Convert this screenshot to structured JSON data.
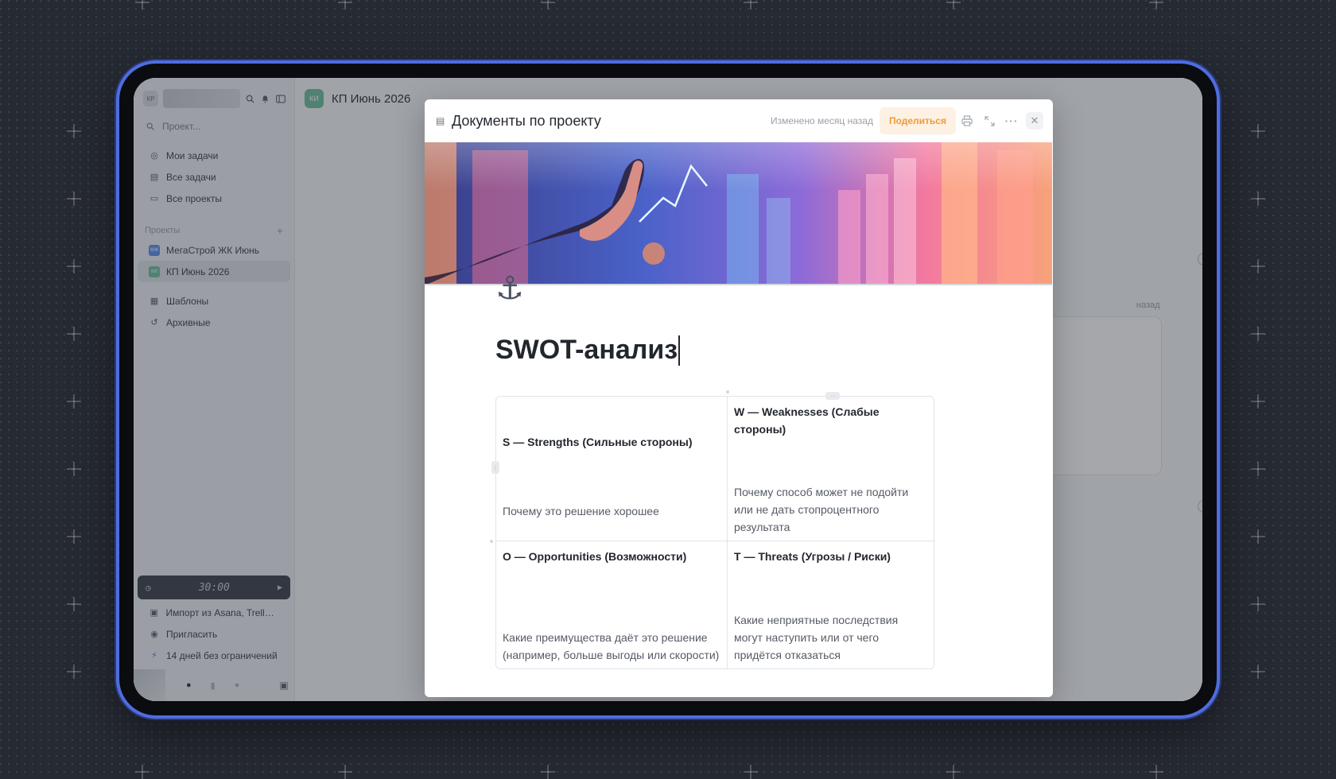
{
  "sidebar": {
    "workspace_badge": "КР",
    "search_placeholder": "Проект...",
    "nav": [
      {
        "label": "Мои задачи",
        "icon": "circle-check-icon"
      },
      {
        "label": "Все задачи",
        "icon": "tasks-icon"
      },
      {
        "label": "Все проекты",
        "icon": "folder-icon"
      }
    ],
    "projects_heading": "Проекты",
    "projects": [
      {
        "label": "МегаСтрой ЖК Июнь",
        "badge": "МЖ",
        "color": "#5b8def"
      },
      {
        "label": "КП Июнь 2026",
        "badge": "КИ",
        "color": "#6bbf9b"
      }
    ],
    "extra": [
      {
        "label": "Шаблоны",
        "icon": "grid-icon"
      },
      {
        "label": "Архивные",
        "icon": "history-icon"
      }
    ],
    "timer": "30:00",
    "bottom": [
      {
        "label": "Импорт из Asana, Trello, ...",
        "icon": "import-icon"
      },
      {
        "label": "Пригласить",
        "icon": "user-add-icon"
      },
      {
        "label": "14 дней без ограничений",
        "icon": "lightning-icon"
      }
    ]
  },
  "main": {
    "project_badge": "КИ",
    "project_title": "КП Июнь 2026",
    "ghost_text": "назад"
  },
  "modal": {
    "title": "Документы по проекту",
    "changed": "Изменено месяц назад",
    "share_label": "Поделиться",
    "page_title": "SWOT-анализ",
    "swot": [
      {
        "heading": "S — Strengths (Сильные стороны)",
        "text": "Почему это решение хорошее"
      },
      {
        "heading": "W — Weaknesses (Слабые стороны)",
        "text": "Почему способ может не подойти или не дать стопроцентного результата"
      },
      {
        "heading": "O — Opportunities (Возможности)",
        "text": "Какие преимущества даёт это решение (например, больше выгоды или скорости)"
      },
      {
        "heading": "T — Threats (Угрозы / Риски)",
        "text": "Какие неприятные последствия могут наступить или от чего придётся отказаться"
      }
    ]
  },
  "colors": {
    "accent_share": "#f09a37",
    "device_border": "#4f6de0"
  }
}
